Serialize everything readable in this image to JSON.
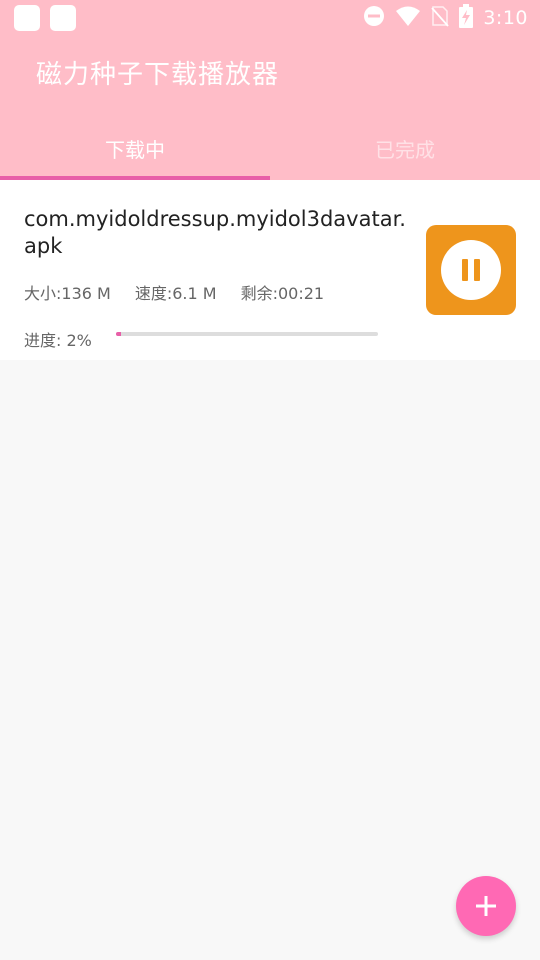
{
  "status_bar": {
    "time": "3:10",
    "icons": [
      "app-notification-icon",
      "app-notification-icon",
      "do-not-disturb-icon",
      "wifi-icon",
      "no-sim-icon",
      "battery-charging-icon"
    ]
  },
  "app": {
    "title": "磁力种子下载播放器"
  },
  "tabs": [
    {
      "label": "下载中",
      "selected": true
    },
    {
      "label": "已完成",
      "selected": false
    }
  ],
  "download": {
    "file_name": "com.myidoldressup.myidol3davatar.apk",
    "size": "大小:136 M",
    "speed": "速度:6.1 M",
    "remaining": "剩余:00:21",
    "progress_label": "进度: 2%",
    "progress": 0.02,
    "action_icon": "pause-icon"
  },
  "fab": {
    "icon": "plus-icon"
  },
  "colors": {
    "primary": "#ffbdc8",
    "accent": "#e85fa8",
    "pause_button": "#ee951c",
    "fab": "#ff69b4"
  }
}
